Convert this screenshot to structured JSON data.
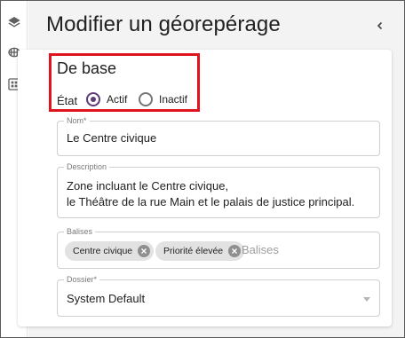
{
  "rail": {
    "items": [
      {
        "icon": "layers-icon"
      },
      {
        "icon": "grid-globe-icon"
      },
      {
        "icon": "dashboard-icon"
      }
    ]
  },
  "header": {
    "title": "Modifier un géorepérage",
    "collapse_icon": "chevron-left-icon"
  },
  "basics": {
    "section_title": "De base",
    "state_label": "État",
    "state_options": [
      {
        "label": "Actif",
        "selected": true
      },
      {
        "label": "Inactif",
        "selected": false
      }
    ],
    "highlight_color": "#e0141e",
    "accent_color": "#5c3b78"
  },
  "form": {
    "name": {
      "label": "Nom*",
      "value": "Le Centre civique"
    },
    "description": {
      "label": "Description",
      "line1": "Zone incluant le Centre civique,",
      "line2": "le Théâtre de la rue Main et le palais de justice principal."
    },
    "tags": {
      "label": "Balises",
      "chips": [
        "Centre civique",
        "Priorité élevée"
      ],
      "placeholder": "Balises"
    },
    "folder": {
      "label": "Dossier*",
      "value": "System Default"
    }
  }
}
